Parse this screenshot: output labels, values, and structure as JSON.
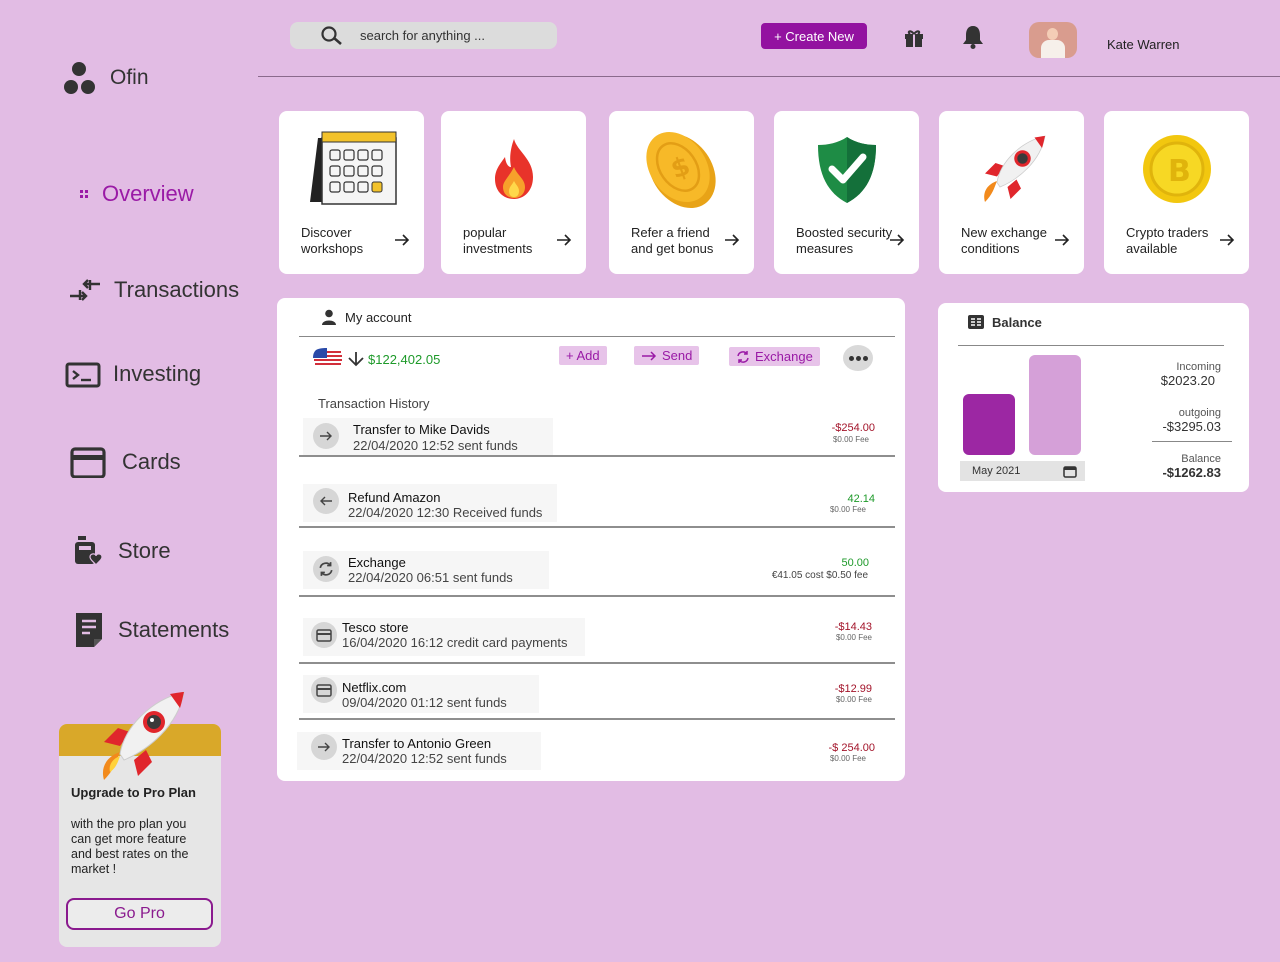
{
  "app": {
    "name": "Ofin"
  },
  "sidebar": {
    "items": [
      {
        "label": "Overview",
        "icon": "grid-icon",
        "active": true
      },
      {
        "label": "Transactions",
        "icon": "transfer-arrows-icon"
      },
      {
        "label": "Investing",
        "icon": "terminal-icon"
      },
      {
        "label": "Cards",
        "icon": "card-icon"
      },
      {
        "label": "Store",
        "icon": "store-icon"
      },
      {
        "label": "Statements",
        "icon": "document-icon"
      }
    ],
    "promo": {
      "title": "Upgrade to Pro Plan",
      "description": "with the pro plan you can get more feature and best rates on the market !",
      "button": "Go Pro"
    }
  },
  "header": {
    "search_placeholder": "search for anything ...",
    "create_label": "+ Create New",
    "user_name": "Kate Warren"
  },
  "features": [
    {
      "label": "Discover workshops",
      "icon": "calendar-icon"
    },
    {
      "label": "popular investments",
      "icon": "fire-icon"
    },
    {
      "label": "Refer a friend and get bonus",
      "icon": "coin-icon"
    },
    {
      "label": "Boosted security measures",
      "icon": "shield-check-icon"
    },
    {
      "label": "New exchange conditions",
      "icon": "rocket-icon"
    },
    {
      "label": "Crypto traders available",
      "icon": "crypto-coin-icon"
    }
  ],
  "account": {
    "title": "My account",
    "balance": "$122,402.05",
    "actions": {
      "add": "+ Add",
      "send": "Send",
      "exchange": "Exchange"
    },
    "history_title": "Transaction History",
    "transactions": [
      {
        "name": "Transfer to Mike Davids",
        "meta": "22/04/2020  12:52  sent funds",
        "amount": "-$254.00",
        "fee": "$0.00 Fee",
        "kind": "neg",
        "icon": "arrow-right-icon"
      },
      {
        "name": "Refund Amazon",
        "meta": "22/04/2020 12:30 Received funds",
        "amount": "42.14",
        "fee": "$0.00 Fee",
        "kind": "pos",
        "icon": "arrow-left-icon"
      },
      {
        "name": "Exchange",
        "meta": "22/04/2020 06:51 sent funds",
        "amount": "50.00",
        "fee": "€41.05 cost $0.50 fee",
        "kind": "pos",
        "icon": "exchange-icon"
      },
      {
        "name": "Tesco store",
        "meta": "16/04/2020 16:12 credit card payments",
        "amount": "-$14.43",
        "fee": "$0.00 Fee",
        "kind": "neg",
        "icon": "card-icon"
      },
      {
        "name": "Netflix.com",
        "meta": "09/04/2020 01:12 sent funds",
        "amount": "-$12.99",
        "fee": "$0.00 Fee",
        "kind": "neg",
        "icon": "card-icon"
      },
      {
        "name": "Transfer to Antonio Green",
        "meta": "22/04/2020  12:52  sent funds",
        "amount": "-$ 254.00",
        "fee": "$0.00 Fee",
        "kind": "neg",
        "icon": "arrow-right-icon"
      }
    ]
  },
  "balance": {
    "title": "Balance",
    "date": "May 2021",
    "incoming_label": "Incoming",
    "incoming": "$2023.20",
    "outgoing_label": "outgoing",
    "outgoing": "-$3295.03",
    "balance_label": "Balance",
    "balance": "-$1262.83",
    "bars": [
      {
        "name": "Incoming",
        "value": 2023.2,
        "color": "#9c27a3"
      },
      {
        "name": "outgoing",
        "value": 3295.03,
        "color": "#d5a0d8"
      }
    ]
  },
  "colors": {
    "accent": "#9312a0",
    "negative": "#a3142a",
    "positive": "#1e9a2a",
    "background": "#e2bce4"
  }
}
